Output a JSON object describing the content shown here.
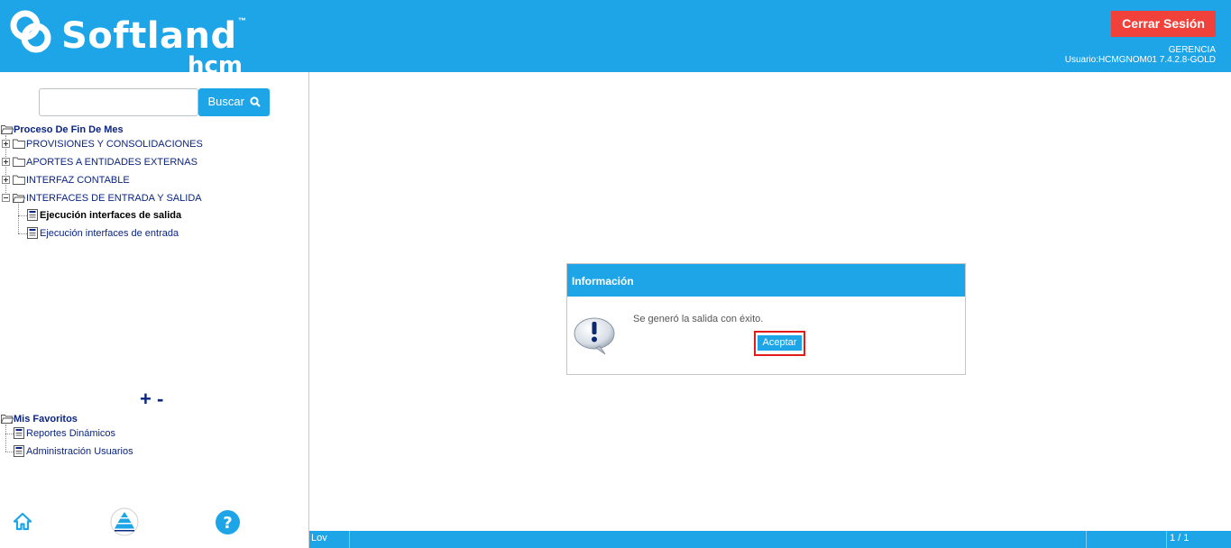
{
  "header": {
    "brand": "Softland",
    "brand_tm": "™",
    "brand_sub": "hcm",
    "logout_label": "Cerrar Sesión",
    "role": "GERENCIA",
    "user_info": "Usuario:HCMGNOM01 7.4.2.8-GOLD",
    "bg_color": "#1ea5e8",
    "logout_color": "#f0423a"
  },
  "sidebar": {
    "search": {
      "value": "",
      "placeholder": "",
      "button_label": "Buscar"
    },
    "tree": {
      "root": "Proceso De Fin De Mes",
      "folders": [
        {
          "label": "PROVISIONES Y CONSOLIDACIONES",
          "expanded": false
        },
        {
          "label": "APORTES A ENTIDADES EXTERNAS",
          "expanded": false
        },
        {
          "label": "INTERFAZ CONTABLE",
          "expanded": false
        },
        {
          "label": "INTERFACES DE ENTRADA Y SALIDA",
          "expanded": true
        }
      ],
      "items": [
        {
          "label": "Ejecución interfaces de salida",
          "selected": true
        },
        {
          "label": "Ejecución interfaces de entrada",
          "selected": false
        }
      ]
    },
    "zoom": {
      "plus": "+",
      "minus": "-"
    },
    "favorites": {
      "root": "Mis Favoritos",
      "items": [
        {
          "label": "Reportes Dinámicos"
        },
        {
          "label": "Administración Usuarios"
        }
      ]
    },
    "footer_icons": [
      "home-icon",
      "pyramid-icon",
      "help-icon"
    ]
  },
  "dialog": {
    "title": "Información",
    "message": "Se generó la salida con éxito.",
    "accept_label": "Aceptar",
    "icon": "exclamation-bubble-icon"
  },
  "statusbar": {
    "left": "Lov",
    "page": "1 / 1"
  }
}
